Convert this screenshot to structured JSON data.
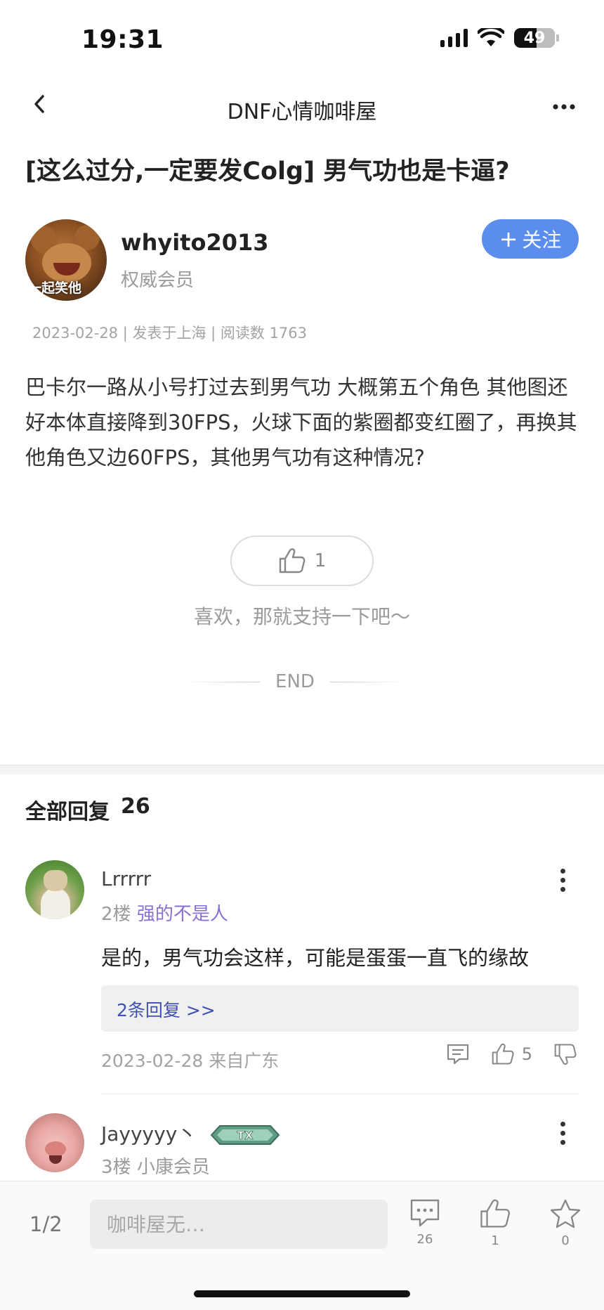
{
  "status_bar": {
    "time": "19:31",
    "battery": "49"
  },
  "nav": {
    "title": "DNF心情咖啡屋"
  },
  "post": {
    "title": "[这么过分,一定要发Colg] 男气功也是卡逼?",
    "author": {
      "name": "whyito2013",
      "rank": "权威会员",
      "avatar_caption": "一起笑他"
    },
    "follow_label": "关注",
    "meta": "2023-02-28 | 发表于上海 | 阅读数 1763",
    "body": "巴卡尔一路从小号打过去到男气功 大概第五个角色 其他图还好本体直接降到30FPS，火球下面的紫圈都变红圈了，再换其他角色又边60FPS，其他男气功有这种情况?",
    "like_count": "1",
    "like_hint": "喜欢，那就支持一下吧～",
    "end_label": "END"
  },
  "replies": {
    "header_label": "全部回复",
    "count": "26",
    "items": [
      {
        "name": "Lrrrrr",
        "floor": "2楼",
        "tag": "强的不是人",
        "text": "是的，男气功会这样，可能是蛋蛋一直飞的缘故",
        "sub_replies": "2条回复 >>",
        "meta": "2023-02-28 来自广东",
        "likes": "5"
      },
      {
        "name": "Jayyyyy丶",
        "floor": "3楼",
        "tag": "小康会员",
        "badge": "TX"
      }
    ]
  },
  "bottom_bar": {
    "page": "1/2",
    "input_placeholder": "咖啡屋无…",
    "comments_count": "26",
    "likes_count": "1",
    "favorites_count": "0"
  },
  "colors": {
    "accent": "#5b8def",
    "link": "#3f4fb5",
    "tag_purple": "#8a6fd6"
  }
}
